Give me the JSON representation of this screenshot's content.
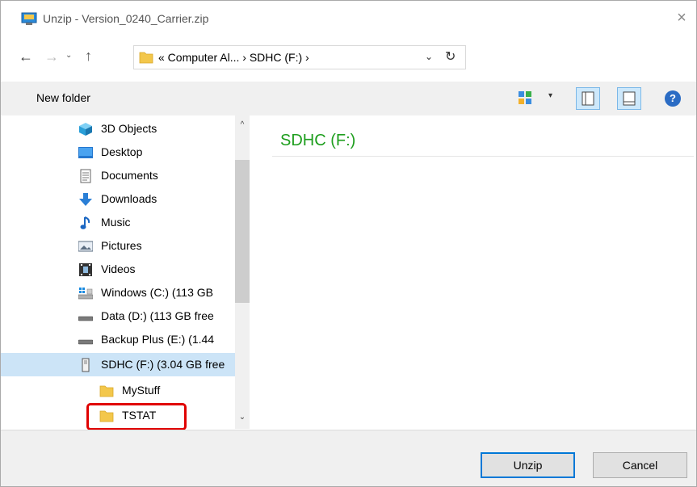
{
  "window": {
    "title": "Unzip - Version_0240_Carrier.zip",
    "close_icon": "×"
  },
  "nav": {
    "back_icon": "←",
    "forward_icon": "→",
    "recent_icon": "⌄",
    "up_icon": "↑",
    "address": "« Computer Al...  ›  SDHC (F:)  ›",
    "dropdown_icon": "⌄",
    "refresh_icon": "↻"
  },
  "toolbar": {
    "new_folder_label": "New folder",
    "views_dropdown_icon": "▾",
    "help_icon": "?"
  },
  "tree": {
    "items": [
      {
        "label": "3D Objects",
        "icon": "cube-icon"
      },
      {
        "label": "Desktop",
        "icon": "desktop-icon"
      },
      {
        "label": "Documents",
        "icon": "documents-icon"
      },
      {
        "label": "Downloads",
        "icon": "download-icon"
      },
      {
        "label": "Music",
        "icon": "music-icon"
      },
      {
        "label": "Pictures",
        "icon": "pictures-icon"
      },
      {
        "label": "Videos",
        "icon": "videos-icon"
      },
      {
        "label": "Windows (C:) (113 GB",
        "icon": "windows-drive-icon"
      },
      {
        "label": "Data (D:) (113 GB free",
        "icon": "drive-icon"
      },
      {
        "label": "Backup Plus (E:) (1.44",
        "icon": "drive-icon"
      },
      {
        "label": "SDHC (F:) (3.04 GB free",
        "icon": "sd-card-icon",
        "selected": true
      },
      {
        "label": "MyStuff",
        "icon": "folder-icon",
        "child": true
      },
      {
        "label": "TSTAT",
        "icon": "folder-icon",
        "child": true
      }
    ],
    "scroll_up_icon": "^",
    "scroll_down_icon": "⌄"
  },
  "content": {
    "heading": "SDHC (F:)"
  },
  "footer": {
    "unzip_label": "Unzip",
    "cancel_label": "Cancel"
  },
  "colors": {
    "heading_green": "#1e9e1e",
    "selection": "#cce4f7",
    "highlight_red": "#e00000",
    "folder_yellow": "#f3c74b"
  }
}
